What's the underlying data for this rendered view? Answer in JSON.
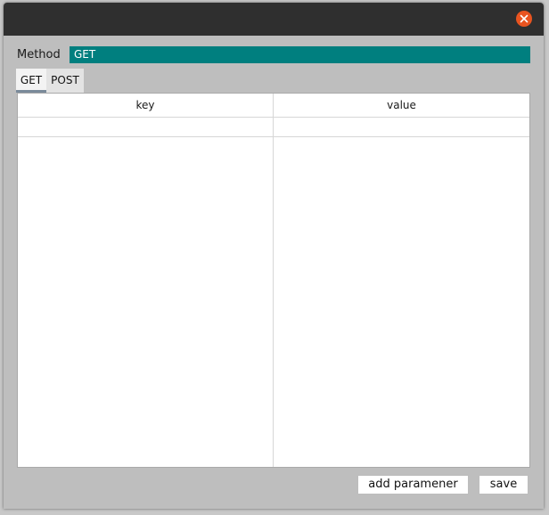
{
  "window": {
    "close_icon": "close-icon",
    "accent_color": "#e95420"
  },
  "method": {
    "label": "Method",
    "value": "GET",
    "field_color": "#007f7f"
  },
  "tabs": [
    {
      "label": "GET",
      "active": true
    },
    {
      "label": "POST",
      "active": false
    }
  ],
  "table": {
    "columns": [
      "key",
      "value"
    ],
    "rows": [
      {
        "key": "",
        "value": ""
      }
    ]
  },
  "buttons": {
    "add_parameter": "add paramener",
    "save": "save"
  }
}
